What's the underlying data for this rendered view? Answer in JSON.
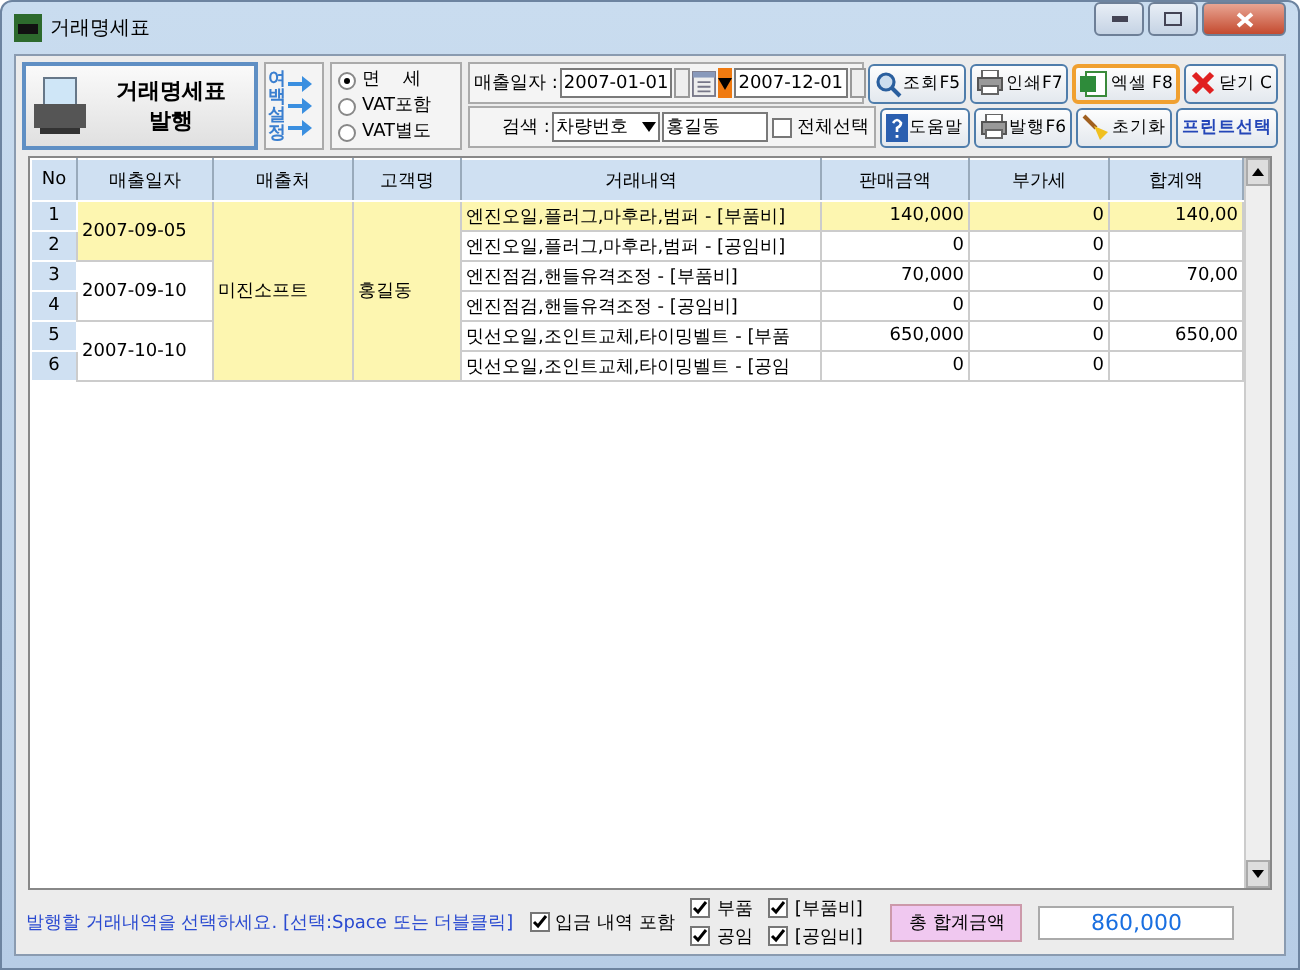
{
  "window": {
    "title": "거래명세표"
  },
  "issue_button": {
    "label_1": "거래명세표",
    "label_2": "발행"
  },
  "margin_button": {
    "label": "여백설정"
  },
  "tax_options": [
    {
      "label": "면    세",
      "selected": true
    },
    {
      "label": "VAT포함",
      "selected": false
    },
    {
      "label": "VAT별도",
      "selected": false
    }
  ],
  "date_filter": {
    "label": "매출일자 :",
    "from": "2007-01-01",
    "to": "2007-12-01"
  },
  "search": {
    "label": "검색 :",
    "field": "차량번호",
    "value": "홍길동",
    "select_all": {
      "label": "전체선택",
      "checked": false
    }
  },
  "buttons_top": [
    {
      "label": "조회F5",
      "kind": "search",
      "highlighted": false
    },
    {
      "label": "인쇄F7",
      "kind": "print",
      "highlighted": false
    },
    {
      "label": "엑셀 F8",
      "kind": "excel",
      "highlighted": true
    },
    {
      "label": "닫기 C",
      "kind": "close",
      "highlighted": false
    }
  ],
  "buttons_bottom": [
    {
      "label": "도움말",
      "kind": "help"
    },
    {
      "label": "발행F6",
      "kind": "print"
    },
    {
      "label": "초기화",
      "kind": "broom"
    },
    {
      "label": "프린트선택",
      "kind": "text"
    }
  ],
  "table": {
    "columns": [
      "No",
      "매출일자",
      "매출처",
      "고객명",
      "거래내역",
      "판매금액",
      "부가세",
      "합계액"
    ],
    "vendor": "미진소프트",
    "customer": "홍길동",
    "groups": [
      {
        "date": "2007-09-05",
        "rows": [
          {
            "no": "1",
            "description": "엔진오일,플러그,마후라,범퍼 - [부품비]",
            "sale": "140,000",
            "vat": "0",
            "total": "140,00",
            "selected": true
          },
          {
            "no": "2",
            "description": "엔진오일,플러그,마후라,범퍼 - [공임비]",
            "sale": "0",
            "vat": "0",
            "selected": false
          }
        ]
      },
      {
        "date": "2007-09-10",
        "rows": [
          {
            "no": "3",
            "description": "엔진점검,핸들유격조정 - [부품비]",
            "sale": "70,000",
            "vat": "0",
            "total": "70,00",
            "selected": false
          },
          {
            "no": "4",
            "description": "엔진점검,핸들유격조정 - [공임비]",
            "sale": "0",
            "vat": "0",
            "selected": false
          }
        ]
      },
      {
        "date": "2007-10-10",
        "rows": [
          {
            "no": "5",
            "description": "밋선오일,조인트교체,타이밍벨트 - [부품",
            "sale": "650,000",
            "vat": "0",
            "total": "650,00",
            "selected": false
          },
          {
            "no": "6",
            "description": "밋선오일,조인트교체,타이밍벨트 - [공임",
            "sale": "0",
            "vat": "0",
            "selected": false
          }
        ]
      }
    ]
  },
  "status": {
    "message": "발행할 거래내역을 선택하세요. [선택:Space 또는 더블클릭]",
    "options": [
      {
        "label": "입금 내역 포함",
        "checked": true
      }
    ],
    "parts": [
      {
        "label": "부품",
        "checked": true
      },
      {
        "label": "공임",
        "checked": true
      }
    ],
    "fees": [
      {
        "label": "[부품비]",
        "checked": true
      },
      {
        "label": "[공임비]",
        "checked": true
      }
    ],
    "total_label": "총 합계금액",
    "total_value": "860,000"
  }
}
